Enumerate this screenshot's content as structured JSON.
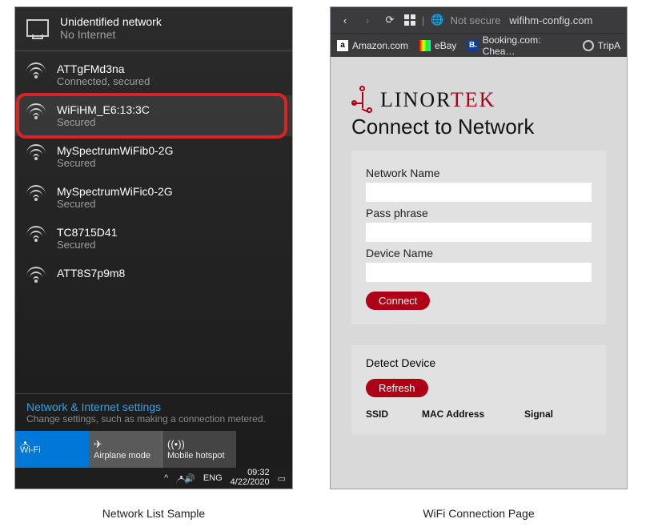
{
  "left_caption": "Network List Sample",
  "right_caption": "WiFi Connection Page",
  "network_header": {
    "title": "Unidentified network",
    "subtitle": "No Internet"
  },
  "networks": [
    {
      "name": "ATTgFMd3na",
      "status": "Connected, secured"
    },
    {
      "name": "WiFiHM_E6:13:3C",
      "status": "Secured"
    },
    {
      "name": "MySpectrumWiFib0-2G",
      "status": "Secured"
    },
    {
      "name": "MySpectrumWiFic0-2G",
      "status": "Secured"
    },
    {
      "name": "TC8715D41",
      "status": "Secured"
    },
    {
      "name": "ATT8S7p9m8",
      "status": ""
    }
  ],
  "settings": {
    "title": "Network & Internet settings",
    "subtitle": "Change settings, such as making a connection metered."
  },
  "tiles": {
    "wifi": "Wi-Fi",
    "air": "Airplane mode",
    "hot": "Mobile hotspot"
  },
  "tray": {
    "lang": "ENG",
    "time": "09:32",
    "date": "4/22/2020"
  },
  "browser": {
    "not_secure": "Not secure",
    "url": "wifihm-config.com",
    "bookmarks": [
      "Amazon.com",
      "eBay",
      "Booking.com: Chea…",
      "TripA"
    ]
  },
  "page": {
    "brand1": "LINOR",
    "brand2": "TEK",
    "heading": "Connect to Network",
    "f1": "Network Name",
    "f2": "Pass phrase",
    "f3": "Device Name",
    "connect": "Connect",
    "detect": "Detect Device",
    "refresh": "Refresh",
    "col1": "SSID",
    "col2": "MAC Address",
    "col3": "Signal"
  }
}
